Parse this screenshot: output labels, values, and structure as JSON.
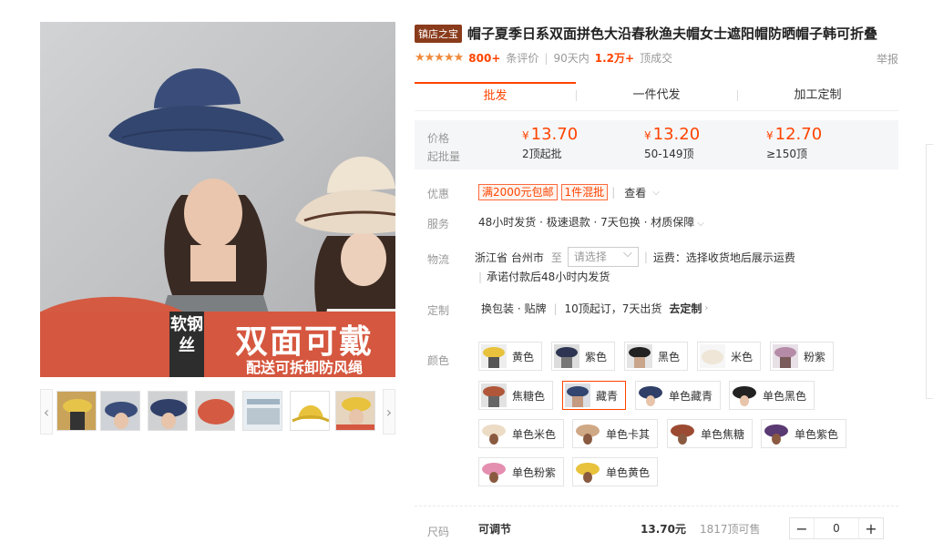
{
  "gallery": {
    "banner_tag": "软钢丝",
    "banner_title": "双面可戴",
    "banner_sub": "配送可拆卸防风绳",
    "prev_icon": "‹",
    "next_icon": "›"
  },
  "product": {
    "badge": "镇店之宝",
    "title": "帽子夏季日系双面拼色大沿春秋渔夫帽女士遮阳帽防晒帽子韩可折叠",
    "stars": "★★★★★",
    "reviews_count": "800+",
    "reviews_label": "条评价",
    "sales_period": "90天内",
    "sales_count": "1.2万+",
    "sales_label": "顶成交",
    "report": "举报"
  },
  "tabs": [
    "批发",
    "一件代发",
    "加工定制"
  ],
  "price": {
    "label_price": "价格",
    "label_moq": "起批量",
    "currency": "¥",
    "tiers": [
      {
        "price": "13.70",
        "range": "2顶起批"
      },
      {
        "price": "13.20",
        "range": "50-149顶"
      },
      {
        "price": "12.70",
        "range": "≥150顶"
      }
    ]
  },
  "promotion": {
    "label": "优惠",
    "tags": [
      "满2000元包邮",
      "1件混批"
    ],
    "link": "查看"
  },
  "service": {
    "label": "服务",
    "text": "48小时发货 · 极速退款 · 7天包换 · 材质保障"
  },
  "logistics": {
    "label": "物流",
    "from": "浙江省 台州市",
    "to": "至",
    "placeholder": "请选择",
    "fee": "运费：选择收货地后展示运费",
    "promise": "承诺付款后48小时内发货"
  },
  "customize": {
    "label": "定制",
    "option": "换包装 · 贴牌",
    "terms": "10顶起订，7天出货",
    "link": "去定制"
  },
  "colors": {
    "label": "颜色",
    "items": [
      "黄色",
      "紫色",
      "黑色",
      "米色",
      "粉紫",
      "焦糖色",
      "藏青",
      "单色藏青",
      "单色黑色",
      "单色米色",
      "单色卡其",
      "单色焦糖",
      "单色紫色",
      "单色粉紫",
      "单色黄色"
    ],
    "selected": "藏青"
  },
  "size": {
    "label": "尺码",
    "name": "可调节",
    "price": "13.70元",
    "stock": "1817顶可售",
    "quantity": "0",
    "minus": "−",
    "plus": "+"
  }
}
